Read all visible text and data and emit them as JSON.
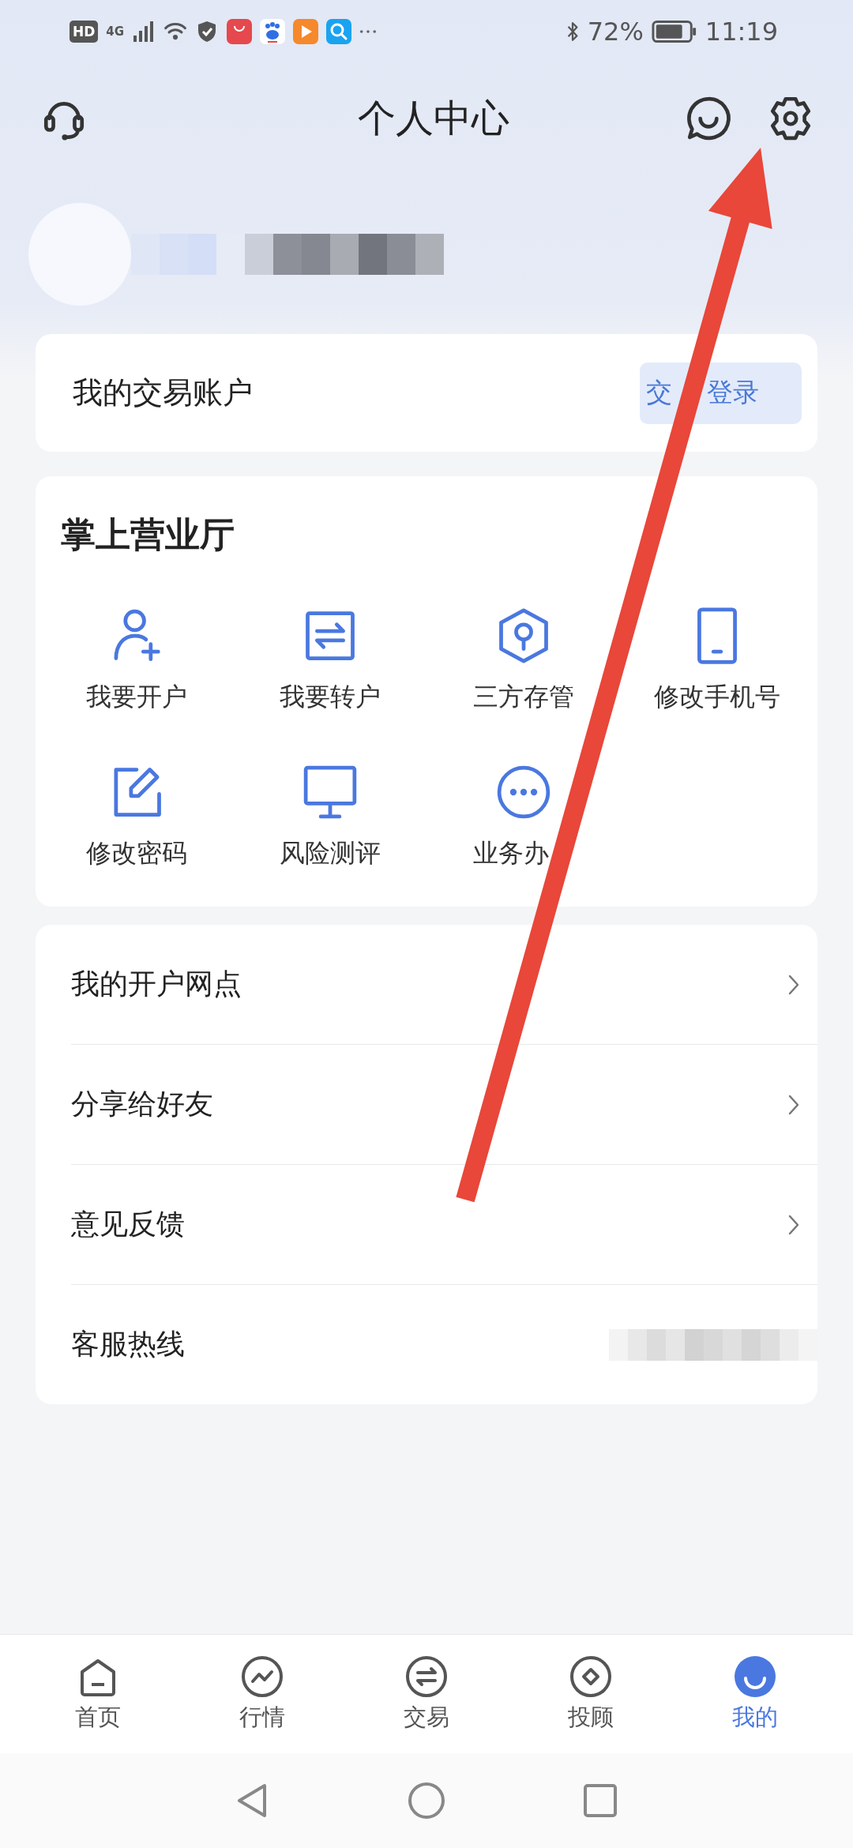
{
  "status_bar": {
    "badges": [
      "HD",
      "4G"
    ],
    "battery": "72%",
    "time": "11:19"
  },
  "header": {
    "title": "个人中心"
  },
  "account_card": {
    "label": "我的交易账户",
    "button": {
      "parts": [
        "交",
        "登录"
      ]
    }
  },
  "service_hall": {
    "title": "掌上营业厅",
    "items": [
      {
        "label": "我要开户",
        "kind": "person-add"
      },
      {
        "label": "我要转户",
        "kind": "transfer"
      },
      {
        "label": "三方存管",
        "kind": "hexagon"
      },
      {
        "label": "修改手机号",
        "kind": "phone"
      },
      {
        "label": "修改密码",
        "kind": "edit"
      },
      {
        "label": "风险测评",
        "kind": "monitor"
      },
      {
        "label": "业务办",
        "kind": "more"
      }
    ]
  },
  "menu": [
    {
      "label": "我的开户网点",
      "kind": "link"
    },
    {
      "label": "分享给好友",
      "kind": "link"
    },
    {
      "label": "意见反馈",
      "kind": "link"
    },
    {
      "label": "客服热线",
      "kind": "hotline"
    }
  ],
  "tab_bar": [
    {
      "label": "首页",
      "kind": "home",
      "selected": false
    },
    {
      "label": "行情",
      "kind": "chart",
      "selected": false
    },
    {
      "label": "交易",
      "kind": "exchange",
      "selected": false
    },
    {
      "label": "投顾",
      "kind": "diamond",
      "selected": false
    },
    {
      "label": "我的",
      "kind": "me",
      "selected": true
    }
  ]
}
